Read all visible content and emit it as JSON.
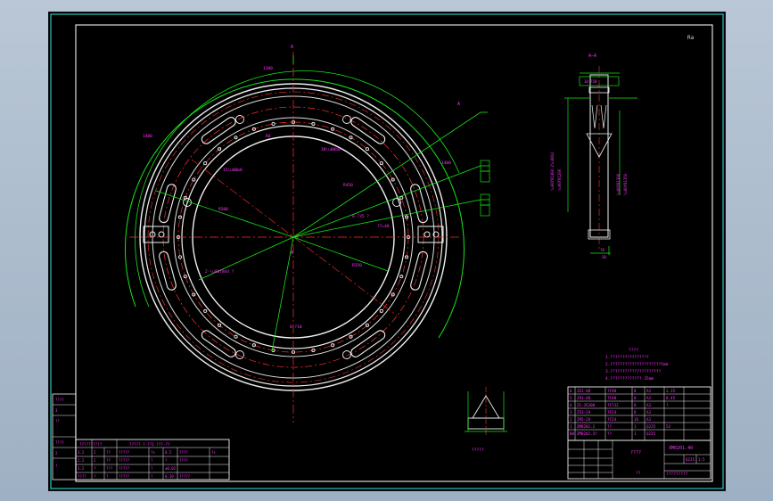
{
  "sheet": {
    "corner_mark": "Ra",
    "view_label_top": "A",
    "section_label": "A—A",
    "view_arrow_left": "A",
    "view_arrow_bottom": "A"
  },
  "notes": {
    "heading": "????",
    "lines": [
      "1.????????????????",
      "2.?????????????????????5mm",
      "3.?????????????????????",
      "4.????????????? 35mm"
    ]
  },
  "parts_list": {
    "rows": [
      [
        "6",
        "ZG1-48",
        "?F48",
        "8",
        "A3",
        "2.15"
      ],
      [
        "5",
        "Z93-48",
        "?F48",
        "8",
        "A3",
        "0.45"
      ],
      [
        "4",
        "Z1-35200",
        "?F?32",
        "8",
        "A3",
        "?"
      ],
      [
        "3",
        "Z53-24",
        "?F24",
        "8",
        "A3",
        ""
      ],
      [
        "2",
        "Z95-24",
        "?F24",
        "16",
        "A3",
        ""
      ],
      [
        "1",
        "ZM8201.2",
        "??",
        "1",
        "Q235",
        "53"
      ],
      [
        "BH",
        "ZM8201.3?",
        "??",
        "1",
        "Q235",
        ""
      ]
    ]
  },
  "title_block": {
    "drawing_no": "XM0201.40",
    "part_name": "????",
    "material": "Q235",
    "scale": "1:5",
    "company": "?????????",
    "drawer": "??"
  },
  "revision_table": {
    "header": [
      "??????????",
      "?????-?-??1 ???-??"
    ],
    "rows": [
      [
        "3.2",
        "2",
        "??",
        "?????",
        "?s",
        "0.5",
        "????",
        "?s"
      ],
      [
        "2.2",
        "2",
        "??",
        "?????",
        "?",
        "?",
        "????",
        ""
      ],
      [
        "3.2",
        "?",
        "???",
        "?????",
        "?",
        "±0.02",
        "",
        ""
      ],
      [
        "????",
        "?",
        "?",
        "?????",
        "?",
        "0.19",
        "?????",
        ""
      ]
    ]
  },
  "left_strip": {
    "cells": [
      "????",
      "3",
      "??",
      "????",
      "2",
      "?"
    ]
  },
  "detail_caption": "?????"
}
